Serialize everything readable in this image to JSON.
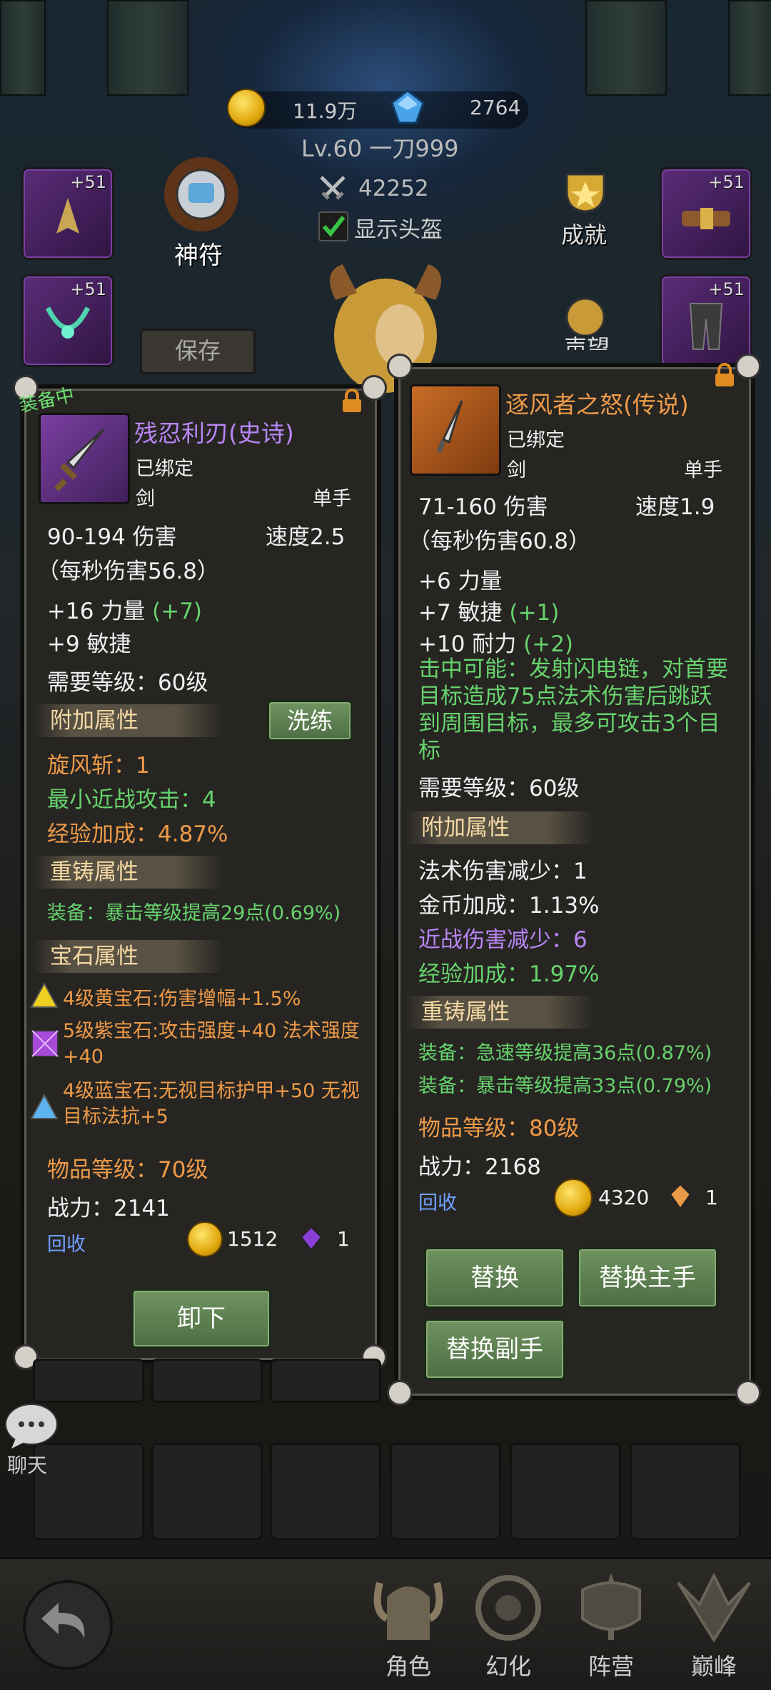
{
  "currency": {
    "gold": "11.9万",
    "gems": "2764"
  },
  "player": {
    "level_name": "Lv.60 一刀999",
    "power": "42252",
    "show_helmet_label": "显示头盔"
  },
  "side_menu": {
    "talisman": "神符",
    "achievement": "成就",
    "save": "保存",
    "reputation": "声望"
  },
  "equip_slots": {
    "slot1": "+51",
    "slot2": "+51",
    "slot3": "+51",
    "slot4": "+51"
  },
  "left_item": {
    "equipped_tag": "装备中",
    "name": "残忍利刃(史诗)",
    "bound": "已绑定",
    "type": "剑",
    "hand": "单手",
    "damage": "90-194 伤害",
    "speed": "速度2.5",
    "dps": "（每秒伤害56.8）",
    "stats": [
      {
        "base": "+16 力量",
        "bonus": "(+7)"
      },
      {
        "base": "+9 敏捷",
        "bonus": ""
      }
    ],
    "req_level": "需要等级：60级",
    "extra_title": "附加属性",
    "reroll": "洗练",
    "extra": [
      "旋风斩：1",
      "最小近战攻击：4",
      "经验加成：4.87%"
    ],
    "reforge_title": "重铸属性",
    "reforge": [
      "装备：暴击等级提高29点(0.69%)"
    ],
    "gem_title": "宝石属性",
    "gems": [
      "4级黄宝石:伤害增幅+1.5%",
      "5级紫宝石:攻击强度+40 法术强度+40",
      "4级蓝宝石:无视目标护甲+50 无视目标法抗+5"
    ],
    "item_level": "物品等级：70级",
    "power": "战力：2141",
    "recycle": "回收",
    "gold": "1512",
    "shard": "1",
    "unequip": "卸下"
  },
  "right_item": {
    "name": "逐风者之怒(传说)",
    "bound": "已绑定",
    "type": "剑",
    "hand": "单手",
    "damage": "71-160 伤害",
    "speed": "速度1.9",
    "dps": "（每秒伤害60.8）",
    "stats": [
      {
        "base": "+6 力量",
        "bonus": ""
      },
      {
        "base": "+7 敏捷",
        "bonus": "(+1)"
      },
      {
        "base": "+10 耐力",
        "bonus": "(+2)"
      }
    ],
    "proc": "击中可能：发射闪电链，对首要目标造成75点法术伤害后跳跃到周围目标，最多可攻击3个目标",
    "req_level": "需要等级：60级",
    "extra_title": "附加属性",
    "extra": [
      "法术伤害减少：1",
      "金币加成：1.13%",
      "近战伤害减少：6",
      "经验加成：1.97%"
    ],
    "reforge_title": "重铸属性",
    "reforge": [
      "装备：急速等级提高36点(0.87%)",
      "装备：暴击等级提高33点(0.79%)"
    ],
    "item_level": "物品等级：80级",
    "power": "战力：2168",
    "recycle": "回收",
    "gold": "4320",
    "shard": "1",
    "replace": "替换",
    "replace_main": "替换主手",
    "replace_off": "替换副手"
  },
  "chat_label": "聊天",
  "nav": {
    "tabs": [
      "角色",
      "幻化",
      "阵营",
      "巅峰"
    ],
    "active": "角色"
  },
  "colors": {
    "epic": "#b886f5",
    "legendary": "#ee9a48",
    "bonus": "#67d36c",
    "button": "#5b7e4f"
  }
}
